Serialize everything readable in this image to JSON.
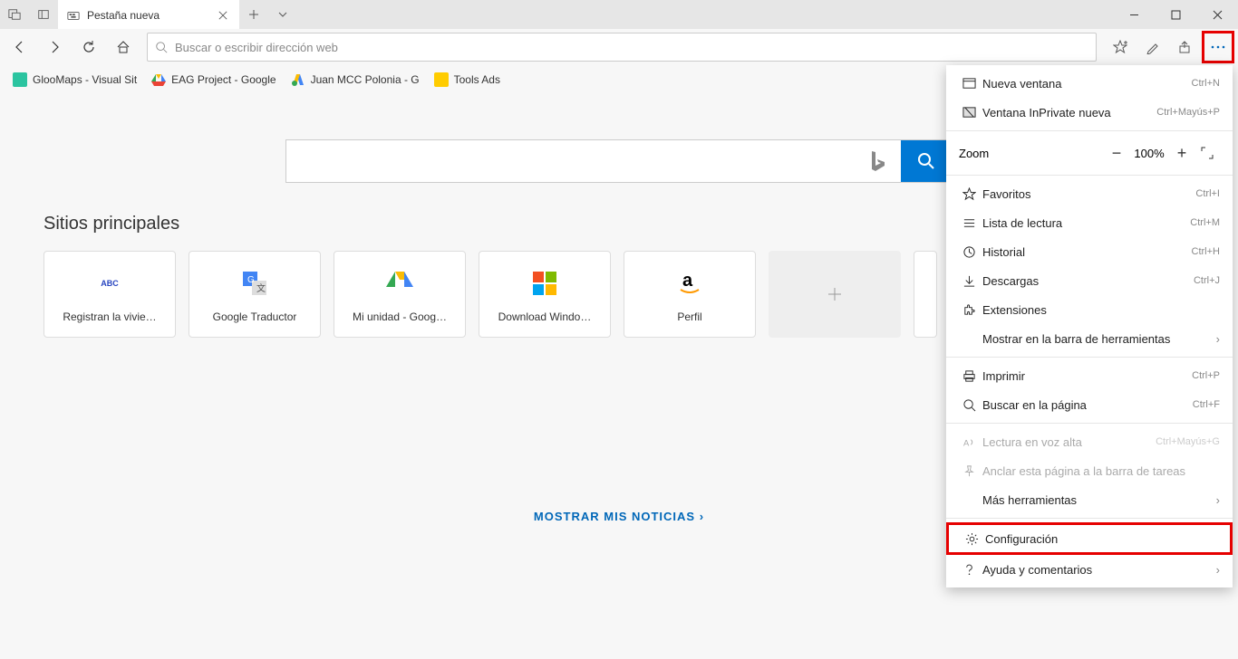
{
  "tab": {
    "title": "Pestaña nueva"
  },
  "urlbar": {
    "placeholder": "Buscar o escribir dirección web"
  },
  "bookmarks": [
    {
      "label": "GlooMaps - Visual Sit",
      "color": "#2bc4a0",
      "glyph": ""
    },
    {
      "label": "EAG Project - Google",
      "color": "",
      "glyph": "drive"
    },
    {
      "label": "Juan MCC Polonia - G",
      "color": "",
      "glyph": "ads"
    },
    {
      "label": "Tools Ads",
      "color": "#ffcc00",
      "glyph": "folder"
    }
  ],
  "section_title": "Sitios principales",
  "tiles": [
    {
      "label": "Registran la vivie…",
      "icon": "abc"
    },
    {
      "label": "Google Traductor",
      "icon": "translate"
    },
    {
      "label": "Mi unidad - Goog…",
      "icon": "drive"
    },
    {
      "label": "Download Windo…",
      "icon": "ms"
    },
    {
      "label": "Perfil",
      "icon": "amazon"
    }
  ],
  "show_news": "MOSTRAR MIS NOTICIAS",
  "menu": {
    "new_window": "Nueva ventana",
    "new_window_sc": "Ctrl+N",
    "inprivate": "Ventana InPrivate nueva",
    "inprivate_sc": "Ctrl+Mayús+P",
    "zoom_label": "Zoom",
    "zoom_value": "100%",
    "favorites": "Favoritos",
    "favorites_sc": "Ctrl+I",
    "reading": "Lista de lectura",
    "reading_sc": "Ctrl+M",
    "history": "Historial",
    "history_sc": "Ctrl+H",
    "downloads": "Descargas",
    "downloads_sc": "Ctrl+J",
    "extensions": "Extensiones",
    "show_toolbar": "Mostrar en la barra de herramientas",
    "print": "Imprimir",
    "print_sc": "Ctrl+P",
    "find": "Buscar en la página",
    "find_sc": "Ctrl+F",
    "read_aloud": "Lectura en voz alta",
    "read_aloud_sc": "Ctrl+Mayús+G",
    "pin": "Anclar esta página a la barra de tareas",
    "more_tools": "Más herramientas",
    "settings": "Configuración",
    "help": "Ayuda y comentarios"
  }
}
